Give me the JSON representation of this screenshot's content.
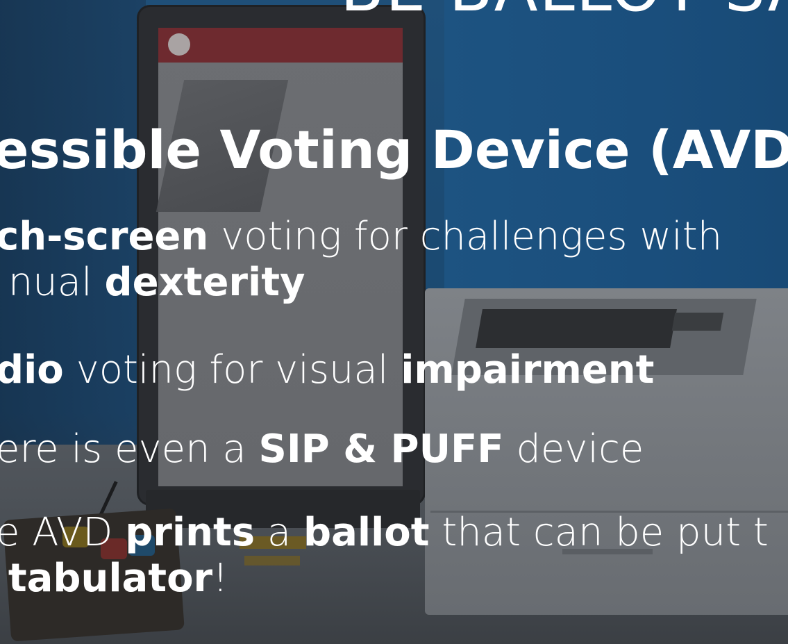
{
  "slide": {
    "title": "BE BALLOT SA",
    "heading": "essible Voting Device (AVD)",
    "bullets": [
      {
        "line1": [
          {
            "text": "ch-screen",
            "bold": true
          },
          {
            "text": " voting for challenges with",
            "bold": false
          }
        ],
        "line2": [
          {
            "text": "nual ",
            "bold": false
          },
          {
            "text": "dexterity",
            "bold": true
          }
        ]
      },
      {
        "line1": [
          {
            "text": "dio",
            "bold": true
          },
          {
            "text": " voting for visual ",
            "bold": false
          },
          {
            "text": "impairment",
            "bold": true
          }
        ]
      },
      {
        "line1": [
          {
            "text": "ere is even a ",
            "bold": false
          },
          {
            "text": "SIP & PUFF",
            "bold": true
          },
          {
            "text": " device",
            "bold": false
          }
        ]
      },
      {
        "line1": [
          {
            "text": "e AVD ",
            "bold": false
          },
          {
            "text": "prints",
            "bold": true
          },
          {
            "text": " a ",
            "bold": false
          },
          {
            "text": "ballot",
            "bold": true
          },
          {
            "text": " that can be put t",
            "bold": false
          }
        ],
        "line2": [
          {
            "text": "tabulator",
            "bold": true
          },
          {
            "text": "!",
            "bold": false
          }
        ]
      }
    ]
  },
  "colors": {
    "text": "#ffffff",
    "wall": "#1f4f78",
    "table": "#52575d"
  }
}
